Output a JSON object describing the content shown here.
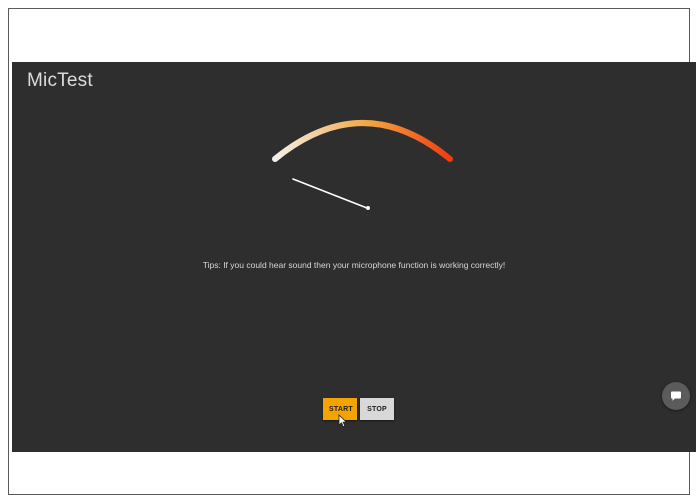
{
  "app": {
    "title": "MicTest"
  },
  "meter": {
    "level": 0.0,
    "colors": {
      "arc_start": "#f4f0e8",
      "arc_mid": "#f2a23c",
      "arc_end": "#f03a12",
      "needle": "#ffffff"
    }
  },
  "tips": {
    "text": "Tips: If you could hear sound then your microphone function is working correctly!"
  },
  "controls": {
    "start_label": "START",
    "stop_label": "STOP"
  },
  "icons": {
    "chat": "chat-bubble-icon",
    "cursor": "mouse-pointer-icon"
  }
}
